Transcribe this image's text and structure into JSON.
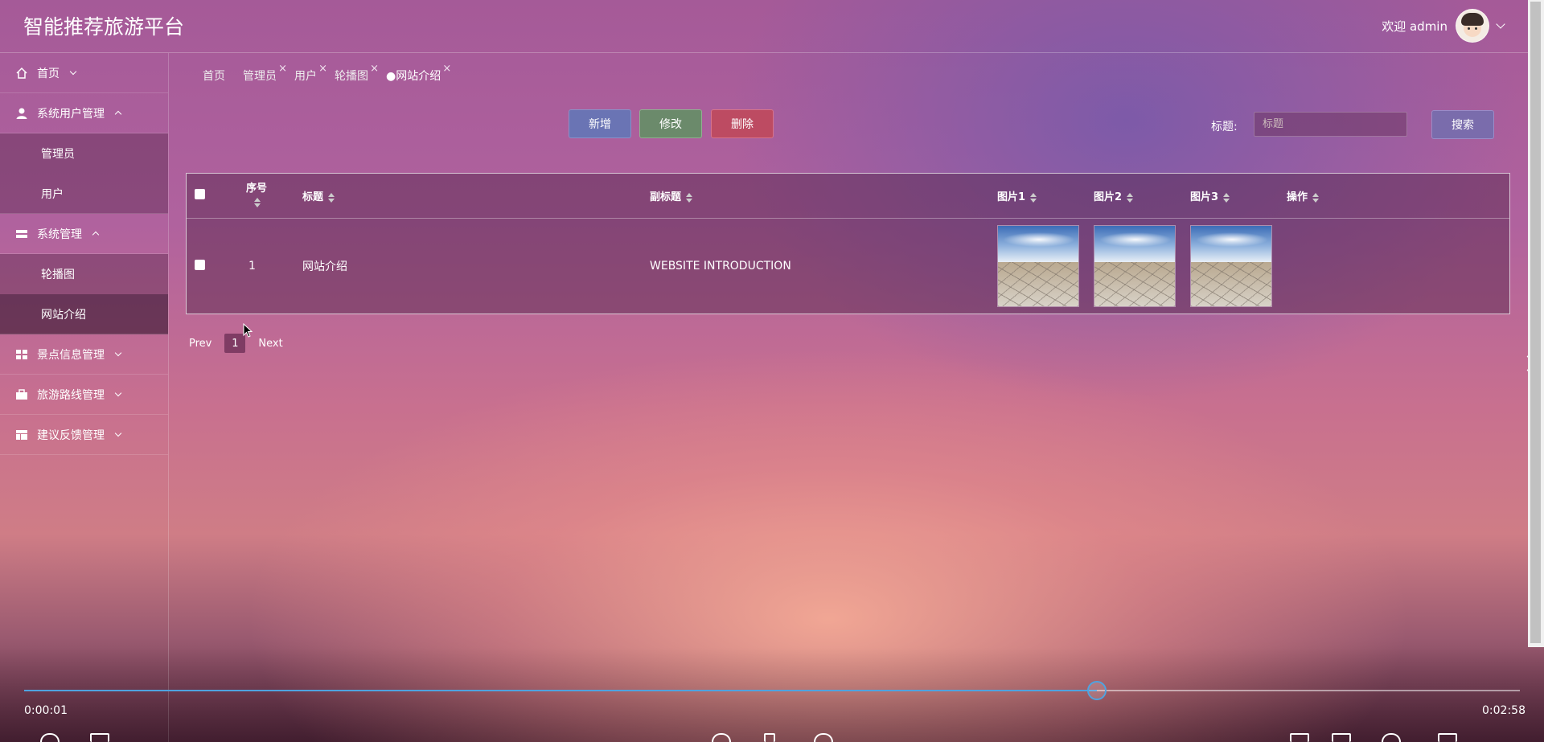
{
  "header": {
    "title": "智能推荐旅游平台",
    "welcome": "欢迎 admin"
  },
  "sidebar": {
    "items": [
      {
        "label": "首页",
        "icon": "home-icon"
      },
      {
        "label": "系统用户管理",
        "icon": "user-icon",
        "children": [
          "管理员",
          "用户"
        ]
      },
      {
        "label": "系统管理",
        "icon": "system-icon",
        "children": [
          "轮播图",
          "网站介绍"
        ]
      },
      {
        "label": "景点信息管理",
        "icon": "grid-icon"
      },
      {
        "label": "旅游路线管理",
        "icon": "briefcase-icon"
      },
      {
        "label": "建议反馈管理",
        "icon": "layout-icon"
      }
    ],
    "active": "网站介绍"
  },
  "tabs": [
    {
      "label": "首页"
    },
    {
      "label": "管理员",
      "close": "×"
    },
    {
      "label": "用户",
      "close": "×"
    },
    {
      "label": "轮播图",
      "close": "×"
    },
    {
      "label": "●网站介绍",
      "close": "×"
    }
  ],
  "toolbar": {
    "add": "新增",
    "edit": "修改",
    "delete": "删除"
  },
  "search": {
    "label": "标题:",
    "placeholder": "标题",
    "button": "搜索"
  },
  "table": {
    "columns": [
      "序号",
      "标题",
      "副标题",
      "图片1",
      "图片2",
      "图片3",
      "操作"
    ],
    "rows": [
      {
        "index": "1",
        "title": "网站介绍",
        "subtitle": "WEBSITE INTRODUCTION",
        "images": [
          "desert-photo",
          "desert-photo",
          "desert-photo"
        ],
        "actions": ""
      }
    ]
  },
  "pager": {
    "prev": "Prev",
    "page": "1",
    "next": "Next"
  },
  "video": {
    "current_time": "0:00:01",
    "duration": "0:02:58",
    "progress": 0.717,
    "accent": "#4fa3e0"
  }
}
